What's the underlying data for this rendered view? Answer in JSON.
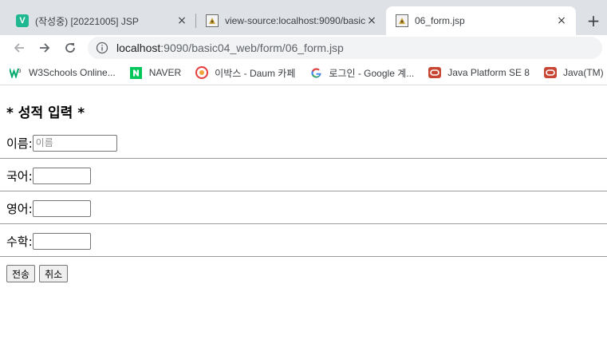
{
  "tabs": [
    {
      "title": "(작성중) [20221005] JSP",
      "favicon": "v-icon",
      "active": false
    },
    {
      "title": "view-source:localhost:9090/basic",
      "favicon": "document-icon",
      "active": false
    },
    {
      "title": "06_form.jsp",
      "favicon": "document-icon",
      "active": true
    }
  ],
  "tabs_close": "×",
  "new_tab": "+",
  "favicon_v_letter": "V",
  "address": {
    "host": "localhost",
    "path": ":9090/basic04_web/form/06_form.jsp"
  },
  "bookmarks": [
    {
      "label": "W3Schools Online...",
      "icon": "w3schools-icon"
    },
    {
      "label": "NAVER",
      "icon": "naver-icon"
    },
    {
      "label": "이박스 - Daum 카페",
      "icon": "daum-icon"
    },
    {
      "label": "로그인 - Google 계...",
      "icon": "google-icon"
    },
    {
      "label": "Java Platform SE 8",
      "icon": "oracle-icon"
    },
    {
      "label": "Java(TM)",
      "icon": "oracle-icon"
    }
  ],
  "form": {
    "title": "* 성적 입력 *",
    "fields": [
      {
        "label": "이름:",
        "placeholder": "이름",
        "value": ""
      },
      {
        "label": "국어:",
        "placeholder": "",
        "value": ""
      },
      {
        "label": "영어:",
        "placeholder": "",
        "value": ""
      },
      {
        "label": "수학:",
        "placeholder": "",
        "value": ""
      }
    ],
    "submit_label": "전송",
    "reset_label": "취소"
  },
  "colors": {
    "tab_strip_bg": "#dee1e6",
    "omnibox_bg": "#f1f3f4",
    "naver_green": "#03c75a",
    "oracle_red": "#c74634"
  }
}
